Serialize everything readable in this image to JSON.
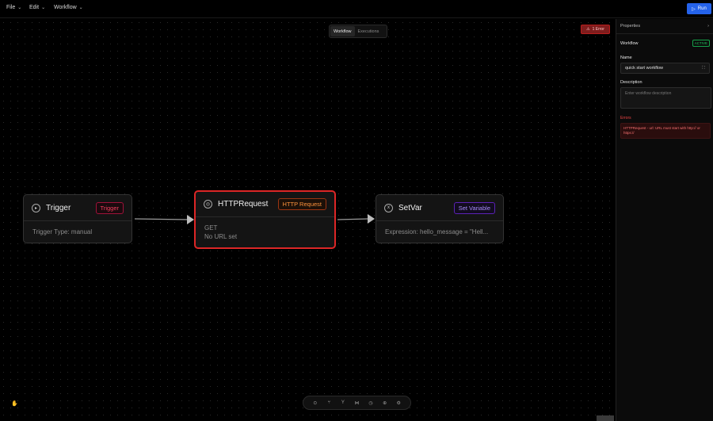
{
  "menubar": {
    "items": [
      {
        "label": "File"
      },
      {
        "label": "Edit"
      },
      {
        "label": "Workflow"
      }
    ],
    "run_label": "Run"
  },
  "view_toggle": {
    "options": [
      "Workflow",
      "Executions"
    ],
    "active": "Workflow"
  },
  "error_pill": {
    "label": "1 Error"
  },
  "nodes": {
    "trigger": {
      "title": "Trigger",
      "tag": "Trigger",
      "body_line1": "Trigger Type: manual"
    },
    "http": {
      "title": "HTTPRequest",
      "tag": "HTTP Request",
      "body_line1": "GET",
      "body_line2": "No URL set"
    },
    "setvar": {
      "title": "SetVar",
      "tag": "Set Variable",
      "body_line1": "Expression: hello_message = \"Hell..."
    }
  },
  "toolbar": {
    "icons": [
      "play-circle-icon",
      "branch-icon",
      "fork-icon",
      "merge-icon",
      "clock-icon",
      "globe-icon",
      "settings-icon"
    ]
  },
  "properties": {
    "header": "Properties",
    "section": "Workflow",
    "status": "ACTIVE",
    "name_label": "Name",
    "name_value": "quick start workflow",
    "description_label": "Description",
    "description_placeholder": "Enter workflow description",
    "errors_label": "Errors",
    "error_message": "HTTPRequest - url: URL must start with http:// or https://"
  },
  "colors": {
    "accent": "#2563eb",
    "error": "#dc2626",
    "trigger_tag": "#f43f5e",
    "http_tag": "#fb923c",
    "setvar_tag": "#a78bfa",
    "active": "#22c55e"
  }
}
